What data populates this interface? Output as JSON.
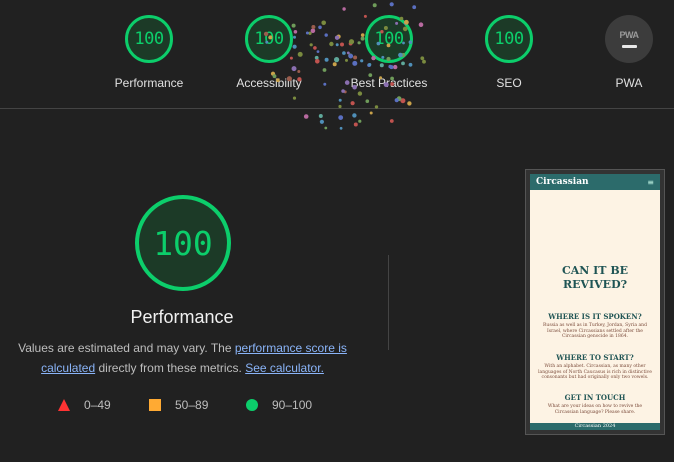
{
  "gauges": [
    {
      "score": "100",
      "label": "Performance"
    },
    {
      "score": "100",
      "label": "Accessibility"
    },
    {
      "score": "100",
      "label": "Best Practices"
    },
    {
      "score": "100",
      "label": "SEO"
    },
    {
      "badge": "PWA",
      "label": "PWA"
    }
  ],
  "main": {
    "score": "100",
    "title": "Performance",
    "desc_pre": "Values are estimated and may vary. The ",
    "link_score": "performance score is calculated",
    "desc_mid": " directly from these metrics. ",
    "link_calc": "See calculator."
  },
  "legend": [
    {
      "range": "0–49",
      "color": "#ff3333"
    },
    {
      "range": "50–89",
      "color": "#ffaa33"
    },
    {
      "range": "90–100",
      "color": "#0cce6b"
    }
  ],
  "screenshot": {
    "brand": "Circassian",
    "headline_1": "CAN IT BE",
    "headline_2": "REVIVED?",
    "sections": [
      {
        "h": "WHERE IS IT SPOKEN?",
        "p": "Russia as well as in Turkey, Jordan, Syria and Israel, where Circassians settled after the Circassian genocide in 1864."
      },
      {
        "h": "WHERE TO START?",
        "p": "With an alphabet. Circassian, as many other languages of North Caucasus is rich in distinctive consonants but had originally only two vowels."
      },
      {
        "h": "GET IN TOUCH",
        "p": "What are your ideas on how to revive the Circassian language? Please share."
      }
    ],
    "footer": "Circassian 2024"
  },
  "colors": {
    "pass": "#0cce6b",
    "average": "#ffaa33",
    "fail": "#ff3333",
    "link": "#8ab4f8"
  }
}
